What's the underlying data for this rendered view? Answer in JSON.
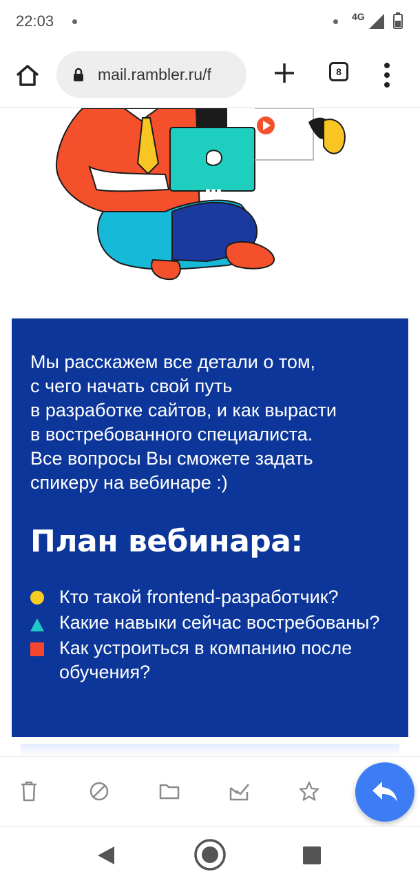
{
  "status_bar": {
    "time": "22:03",
    "network": "4G"
  },
  "browser": {
    "url": "mail.rambler.ru/f",
    "tab_count": "8"
  },
  "email": {
    "intro_text": "Мы расскажем все детали о том,\nс чего начать свой путь\nв разработке сайтов, и как вырасти\nв востребованного специалиста.\nВсе вопросы Вы сможете задать\nспикеру на вебинаре :)",
    "plan_title": "План вебинара:",
    "plan_items": [
      {
        "text": "Кто такой frontend-разработчик?",
        "bullet": "circle",
        "color": "#f8cd22"
      },
      {
        "text": "Какие навыки сейчас востребованы?",
        "bullet": "triangle",
        "color": "#22c8c8"
      },
      {
        "text": "Как устроиться в компанию после обучения?",
        "bullet": "square",
        "color": "#f4462c"
      }
    ],
    "block_color": "#0c3699"
  },
  "actions": {
    "icons": [
      "trash-icon",
      "spam-icon",
      "folder-icon",
      "mark-read-icon",
      "star-icon"
    ],
    "reply_icon": "reply-icon",
    "accent": "#3c7cf4"
  },
  "nav": {
    "icons": [
      "back-icon",
      "home-icon",
      "recent-apps-icon"
    ]
  }
}
